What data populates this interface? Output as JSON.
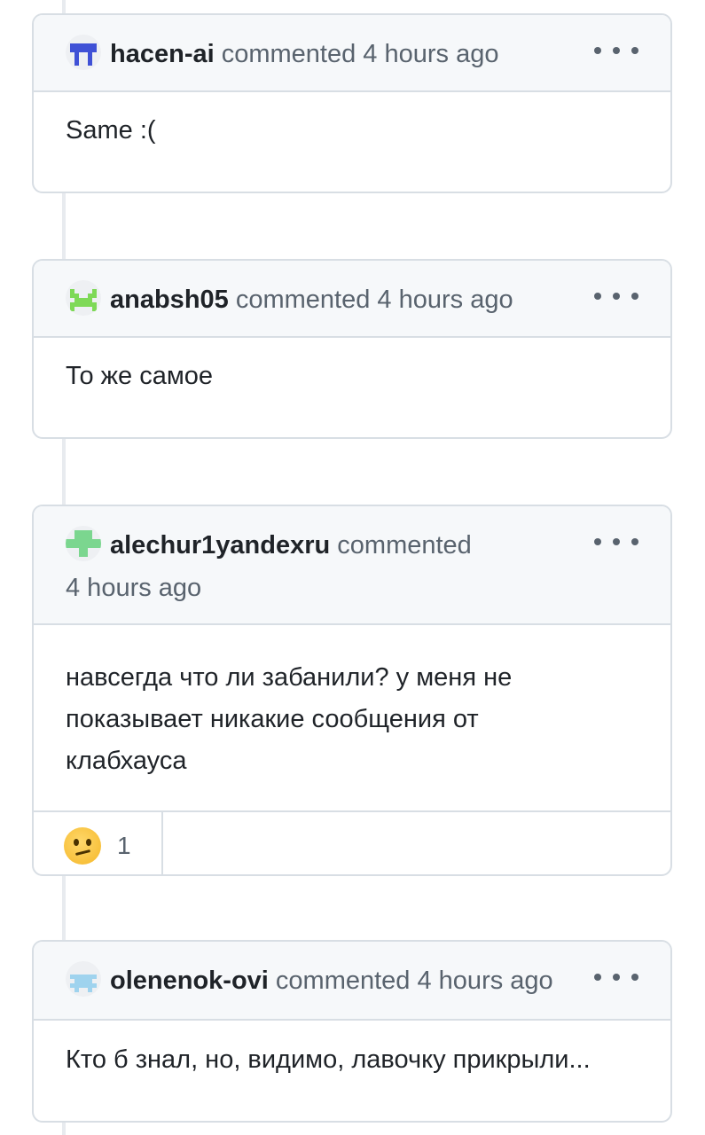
{
  "comments": [
    {
      "author": "hacen-ai",
      "meta": "commented 4 hours ago",
      "body": [
        "Same :("
      ],
      "avatar_color": "#3f51d6"
    },
    {
      "author": "anabsh05",
      "meta": "commented 4 hours ago",
      "body": [
        "То же самое"
      ],
      "avatar_color": "#7ed957"
    },
    {
      "author": "alechur1yandexru",
      "meta": "commented",
      "meta2": "4 hours ago",
      "body": [
        "навсегда что ли забанили? у меня не",
        "показывает никакие сообщения от",
        "клабхауса"
      ],
      "avatar_color": "#7bd68f",
      "reaction": {
        "emoji": "confused-face",
        "count": "1"
      }
    },
    {
      "author": "olenenok-ovi",
      "meta": "commented 4 hours ago",
      "body": [
        "Кто б знал, но, видимо, лавочку прикрыли..."
      ],
      "avatar_color": "#9fd3ee"
    }
  ]
}
